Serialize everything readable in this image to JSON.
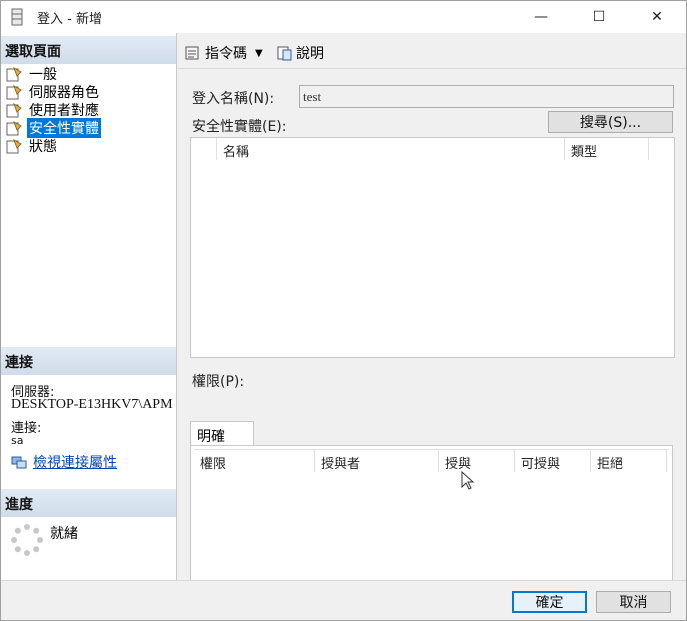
{
  "window": {
    "title": "登入 - 新增",
    "minimize_glyph": "—",
    "maximize_glyph": "☐",
    "close_glyph": "✕"
  },
  "left": {
    "select_page_header": "選取頁面",
    "pages": [
      {
        "label": "一般",
        "icon": "page-icon"
      },
      {
        "label": "伺服器角色",
        "icon": "page-icon"
      },
      {
        "label": "使用者對應",
        "icon": "page-icon"
      },
      {
        "label": "安全性實體",
        "icon": "page-icon",
        "selected": true
      },
      {
        "label": "狀態",
        "icon": "page-icon"
      }
    ],
    "connection_header": "連接",
    "server_label": "伺服器:",
    "server_value": "DESKTOP-E13HKV7\\APM",
    "connection_label": "連接:",
    "connection_value": "sa",
    "view_connection_link": "檢視連接屬性",
    "progress_header": "進度",
    "progress_status": "就緒"
  },
  "toolbar": {
    "script_label": "指令碼",
    "help_label": "說明"
  },
  "form": {
    "login_name_label": "登入名稱(N):",
    "login_name_value": "test",
    "securables_label": "安全性實體(E):",
    "search_button": "搜尋(S)...",
    "securables_columns": [
      "",
      "名稱",
      "類型"
    ],
    "permissions_label": "權限(P):",
    "tab_explicit": "明確",
    "permissions_columns": [
      "權限",
      "授與者",
      "授與",
      "可授與",
      "拒絕"
    ]
  },
  "footer": {
    "ok_button": "確定",
    "cancel_button": "取消"
  },
  "colors": {
    "selection": "#0078d7",
    "section_header": "#d6e1ee",
    "link": "#0645ad"
  }
}
